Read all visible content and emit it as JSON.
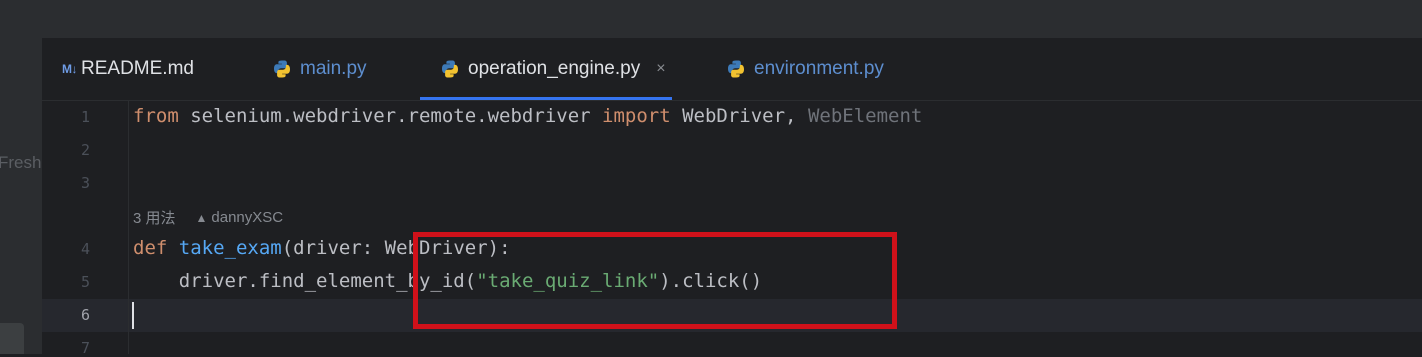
{
  "tabs": [
    {
      "icon": "markdown-icon",
      "icon_text": "M↓",
      "label": "README.md",
      "active": false
    },
    {
      "icon": "python-icon",
      "label": "main.py",
      "active": false
    },
    {
      "icon": "python-icon",
      "label": "operation_engine.py",
      "active": true,
      "close": "×"
    },
    {
      "icon": "python-icon",
      "label": "environment.py",
      "active": false
    }
  ],
  "sidebar": {
    "partial_text": "Fresh"
  },
  "line_numbers": [
    "1",
    "2",
    "3",
    "4",
    "5",
    "6",
    "7"
  ],
  "code": {
    "line1": {
      "kw_from": "from",
      "module": " selenium.webdriver.remote.webdriver ",
      "kw_import": "import",
      "names": " WebDriver, ",
      "unused": "WebElement"
    },
    "hint": {
      "usages": "3 用法",
      "author": "dannyXSC"
    },
    "line4": {
      "kw_def": "def",
      "space": " ",
      "fn_name": "take_exam",
      "sig": "(driver: WebDriver):"
    },
    "line5": {
      "indent": "    ",
      "call": "driver.find_element_by_id(",
      "str": "\"take_quiz_link\"",
      "tail": ").click()"
    }
  },
  "colors": {
    "annotation_box": "#d0111a",
    "active_tab_underline": "#3574f0"
  }
}
